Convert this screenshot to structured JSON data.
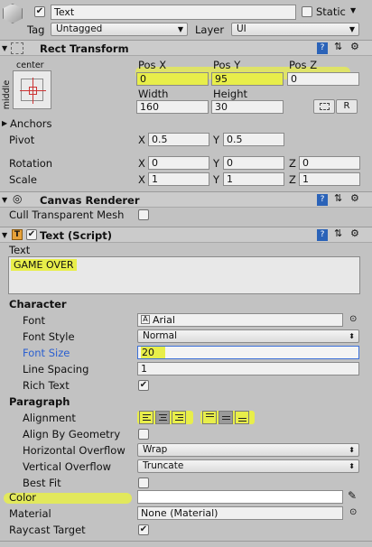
{
  "gameobject": {
    "active": true,
    "name": "Text",
    "static_label": "Static",
    "tag_label": "Tag",
    "tag_value": "Untagged",
    "layer_label": "Layer",
    "layer_value": "UI"
  },
  "rect_transform": {
    "title": "Rect Transform",
    "anchor_top": "center",
    "anchor_side": "middle",
    "pos_x_label": "Pos X",
    "pos_y_label": "Pos Y",
    "pos_z_label": "Pos Z",
    "pos_x": "0",
    "pos_y": "95",
    "pos_z": "0",
    "width_label": "Width",
    "height_label": "Height",
    "width": "160",
    "height": "30",
    "reset_label": "R",
    "anchors_label": "Anchors",
    "pivot_label": "Pivot",
    "pivot_x": "0.5",
    "pivot_y": "0.5",
    "rotation_label": "Rotation",
    "rot_x": "0",
    "rot_y": "0",
    "rot_z": "0",
    "scale_label": "Scale",
    "scale_x": "1",
    "scale_y": "1",
    "scale_z": "1",
    "x": "X",
    "y": "Y",
    "z": "Z"
  },
  "canvas_renderer": {
    "title": "Canvas Renderer",
    "cull_label": "Cull Transparent Mesh",
    "cull": false
  },
  "text_script": {
    "title": "Text (Script)",
    "enabled": true,
    "text_label": "Text",
    "text_value": "GAME OVER",
    "character_header": "Character",
    "font_label": "Font",
    "font_value": "Arial",
    "font_style_label": "Font Style",
    "font_style_value": "Normal",
    "font_size_label": "Font Size",
    "font_size_value": "20",
    "line_spacing_label": "Line Spacing",
    "line_spacing_value": "1",
    "rich_text_label": "Rich Text",
    "rich_text": true,
    "paragraph_header": "Paragraph",
    "alignment_label": "Alignment",
    "align_by_geometry_label": "Align By Geometry",
    "align_by_geometry": false,
    "h_overflow_label": "Horizontal Overflow",
    "h_overflow_value": "Wrap",
    "v_overflow_label": "Vertical Overflow",
    "v_overflow_value": "Truncate",
    "best_fit_label": "Best Fit",
    "best_fit": false,
    "color_label": "Color",
    "color_value": "#FFFFFF",
    "material_label": "Material",
    "material_value": "None (Material)",
    "raycast_label": "Raycast Target",
    "raycast": true
  },
  "highlight_color": "#E8EE4A",
  "focus_color": "#3B6FD8"
}
